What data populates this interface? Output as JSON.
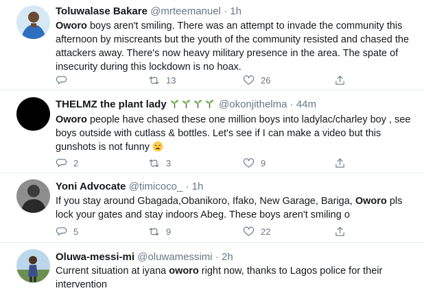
{
  "tweets": [
    {
      "name": "Toluwalase Bakare",
      "handle": "@mrteemanuel",
      "dot": "·",
      "time": "1h",
      "text_lead": "Oworo",
      "text_rest": " boys aren't smiling. There was an attempt to invade the community this afternoon by miscreants but the youth of the community resisted and chased the attackers away. There's now heavy military presence in the area. The spate of insecurity during this lockdown is no hoax.",
      "reply_count": "",
      "retweet_count": "13",
      "like_count": "26"
    },
    {
      "name": "THELMZ the plant lady",
      "name_emoji": [
        "seedling-icon",
        "seedling-icon",
        "seedling-icon",
        "seedling-icon"
      ],
      "handle": "@okonjithelma",
      "dot": "·",
      "time": "44m",
      "text_lead": "Oworo",
      "text_rest": " people have chased these one million boys into ladylac/charley boy , see boys outside with cutlass & bottles. Let's see if I can make a video but this gunshots is not funny ",
      "text_emoji": "weary-face-icon",
      "reply_count": "2",
      "retweet_count": "3",
      "like_count": "9"
    },
    {
      "name": "Yoni Advocate",
      "handle": "@timicoco_",
      "dot": "·",
      "time": "1h",
      "text_pre": "If you stay around Gbagada,Obanikoro, Ifako, New Garage, Bariga, ",
      "text_lead": "Oworo",
      "text_rest": " pls lock your gates and stay indoors Abeg. These boys aren't smiling o",
      "reply_count": "5",
      "retweet_count": "9",
      "like_count": "22"
    },
    {
      "name": "Oluwa-messi-mi",
      "handle": "@oluwamessimi",
      "dot": "·",
      "time": "2h",
      "text_pre": "Current situation at iyana ",
      "text_lead": "oworo",
      "text_rest": " right now, thanks to Lagos police for their intervention"
    }
  ],
  "colors": {
    "text": "#14171a",
    "secondary": "#657786",
    "divider": "#e6ecf0",
    "emoji_green": "#78b159"
  },
  "icons": {
    "reply": "reply-icon",
    "retweet": "retweet-icon",
    "like": "heart-icon",
    "share": "share-icon"
  }
}
